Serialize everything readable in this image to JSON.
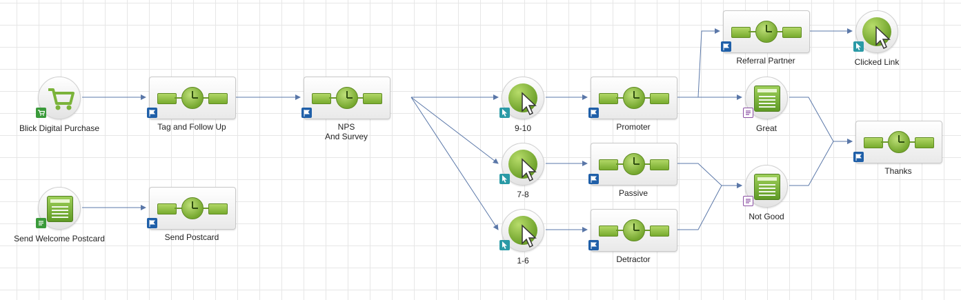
{
  "nodes": [
    {
      "id": "n1",
      "kind": "purchase",
      "label": "Blick Digital Purchase",
      "badge": "cart"
    },
    {
      "id": "n2",
      "kind": "flow",
      "label": "Tag and Follow Up",
      "badge": "flag"
    },
    {
      "id": "n3",
      "kind": "flow",
      "label": "NPS",
      "label2": "And Survey",
      "badge": "flag"
    },
    {
      "id": "n4",
      "kind": "click",
      "label": "9-10",
      "badge": "cursor"
    },
    {
      "id": "n5",
      "kind": "click",
      "label": "7-8",
      "badge": "cursor"
    },
    {
      "id": "n6",
      "kind": "click",
      "label": "1-6",
      "badge": "cursor"
    },
    {
      "id": "n7",
      "kind": "flow",
      "label": "Promoter",
      "badge": "flag"
    },
    {
      "id": "n8",
      "kind": "flow",
      "label": "Passive",
      "badge": "flag"
    },
    {
      "id": "n9",
      "kind": "flow",
      "label": "Detractor",
      "badge": "flag"
    },
    {
      "id": "n10",
      "kind": "flow",
      "label": "Referral Partner",
      "badge": "flag"
    },
    {
      "id": "n11",
      "kind": "click",
      "label": "Clicked Link",
      "badge": "cursor"
    },
    {
      "id": "n12",
      "kind": "form",
      "label": "Great",
      "badge": "form"
    },
    {
      "id": "n13",
      "kind": "form",
      "label": "Not Good",
      "badge": "form"
    },
    {
      "id": "n14",
      "kind": "flow",
      "label": "Thanks",
      "badge": "flag"
    },
    {
      "id": "n15",
      "kind": "form",
      "label": "Send Welcome Postcard",
      "badge": "form-green"
    },
    {
      "id": "n16",
      "kind": "flow",
      "label": "Send Postcard",
      "badge": "flag"
    }
  ],
  "edges": [
    [
      "n1",
      "n2"
    ],
    [
      "n2",
      "n3"
    ],
    [
      "n3",
      "n4"
    ],
    [
      "n3",
      "n5"
    ],
    [
      "n3",
      "n6"
    ],
    [
      "n4",
      "n7"
    ],
    [
      "n5",
      "n8"
    ],
    [
      "n6",
      "n9"
    ],
    [
      "n7",
      "n10"
    ],
    [
      "n10",
      "n11"
    ],
    [
      "n7",
      "n12"
    ],
    [
      "n8",
      "n13"
    ],
    [
      "n9",
      "n13"
    ],
    [
      "n12",
      "n14"
    ],
    [
      "n13",
      "n14"
    ],
    [
      "n15",
      "n16"
    ]
  ],
  "colors": {
    "edge": "#5a77a8",
    "accent_green": "#78ab2e",
    "flag_badge": "#1f5fa8",
    "cursor_badge": "#2a9aa6",
    "form_badge": "#8a4ea2"
  }
}
